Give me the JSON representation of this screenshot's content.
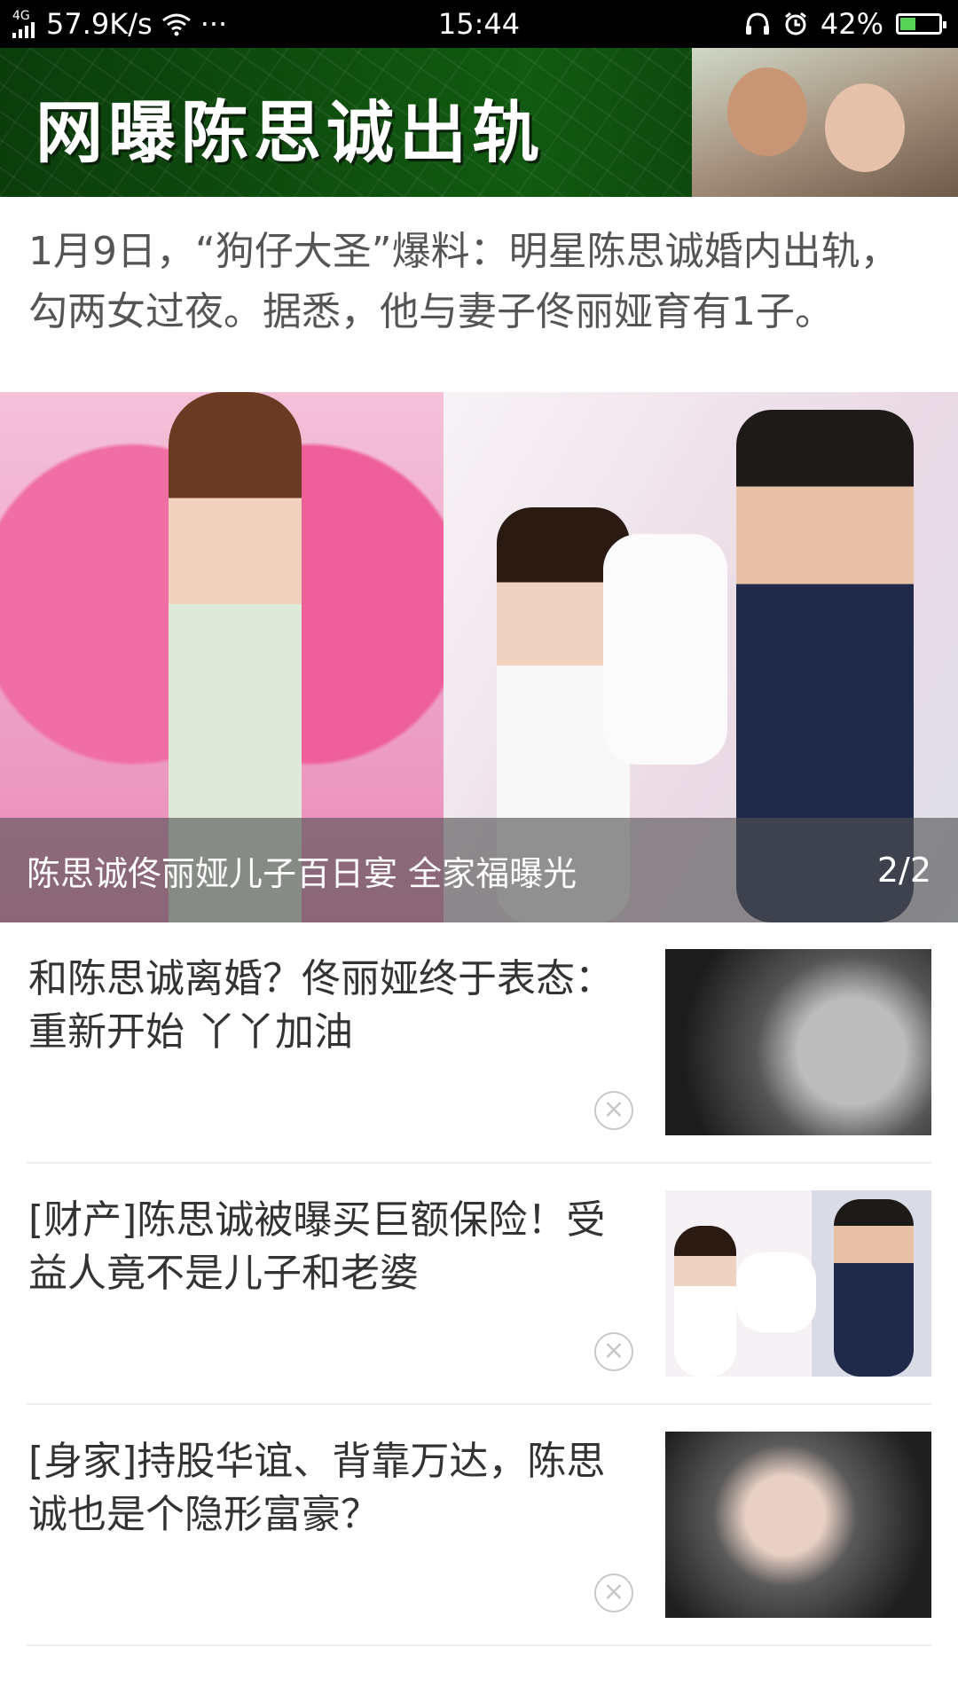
{
  "status_bar": {
    "network_type": "4G",
    "speed": "57.9K/s",
    "more": "···",
    "time": "15:44",
    "battery": "42%",
    "battery_level": 0.42
  },
  "banner": {
    "title": "网曝陈思诚出轨"
  },
  "summary": {
    "text": "1月9日，“狗仔大圣”爆料：明星陈思诚婚内出轨，勾两女过夜。据悉，他与妻子佟丽娅育有1子。"
  },
  "carousel": {
    "caption": "陈思诚佟丽娅儿子百日宴 全家福曝光",
    "pager": "2/2"
  },
  "news": [
    {
      "title": "和陈思诚离婚？佟丽娅终于表态：重新开始 丫丫加油",
      "close_glyph": "×"
    },
    {
      "title": "[财产]陈思诚被曝买巨额保险！受益人竟不是儿子和老婆",
      "close_glyph": "×"
    },
    {
      "title": "[身家]持股华谊、背靠万达，陈思诚也是个隐形富豪？",
      "close_glyph": "×"
    }
  ],
  "colors": {
    "statusbar_bg": "#000000",
    "banner_green": "#115a11",
    "battery_fill": "#57d257"
  }
}
